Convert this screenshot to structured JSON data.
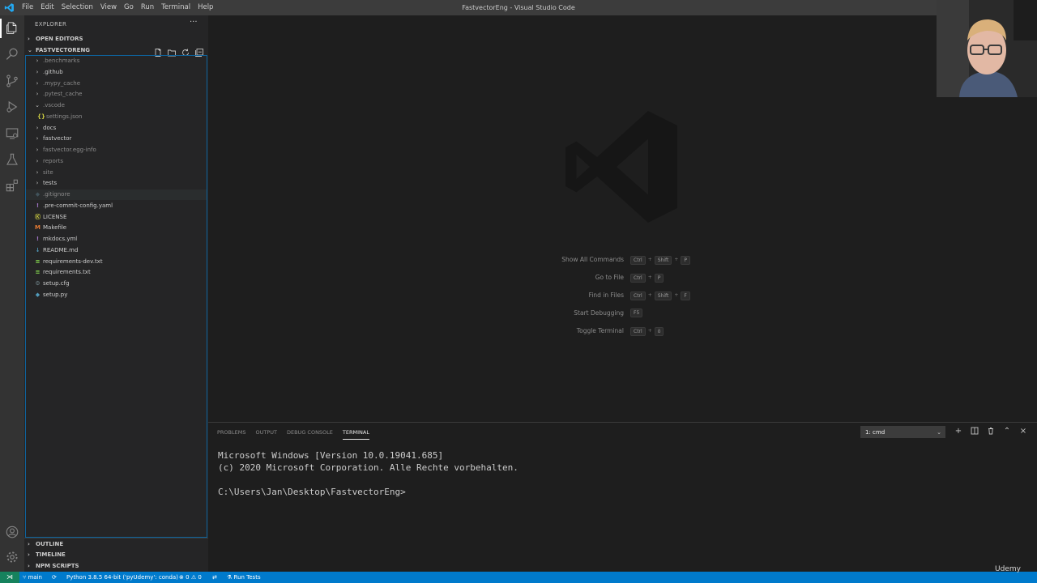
{
  "menu": [
    "File",
    "Edit",
    "Selection",
    "View",
    "Go",
    "Run",
    "Terminal",
    "Help"
  ],
  "window_title": "FastvectorEng - Visual Studio Code",
  "sidebar": {
    "title": "EXPLORER",
    "more_glyph": "···",
    "open_editors": "OPEN EDITORS",
    "root": "FASTVECTORENG",
    "tree": [
      {
        "label": ".benchmarks",
        "kind": "folder",
        "state": "collapsed",
        "dim": true
      },
      {
        "label": ".github",
        "kind": "folder",
        "state": "collapsed",
        "dim": false
      },
      {
        "label": ".mypy_cache",
        "kind": "folder",
        "state": "collapsed",
        "dim": true
      },
      {
        "label": ".pytest_cache",
        "kind": "folder",
        "state": "collapsed",
        "dim": true
      },
      {
        "label": ".vscode",
        "kind": "folder",
        "state": "expanded",
        "dim": true
      },
      {
        "label": "settings.json",
        "kind": "file",
        "icon": "json-icon",
        "dim": true,
        "child": true
      },
      {
        "label": "docs",
        "kind": "folder",
        "state": "collapsed",
        "dim": false
      },
      {
        "label": "fastvector",
        "kind": "folder",
        "state": "collapsed",
        "dim": false
      },
      {
        "label": "fastvector.egg-info",
        "kind": "folder",
        "state": "collapsed",
        "dim": true
      },
      {
        "label": "reports",
        "kind": "folder",
        "state": "collapsed",
        "dim": true
      },
      {
        "label": "site",
        "kind": "folder",
        "state": "collapsed",
        "dim": true
      },
      {
        "label": "tests",
        "kind": "folder",
        "state": "collapsed",
        "dim": false
      },
      {
        "label": ".gitignore",
        "kind": "file",
        "icon": "git-icon",
        "dim": true,
        "hover": true
      },
      {
        "label": ".pre-commit-config.yaml",
        "kind": "file",
        "icon": "yaml-icon",
        "dim": false
      },
      {
        "label": "LICENSE",
        "kind": "file",
        "icon": "license-icon",
        "dim": false
      },
      {
        "label": "Makefile",
        "kind": "file",
        "icon": "makefile-icon",
        "dim": false
      },
      {
        "label": "mkdocs.yml",
        "kind": "file",
        "icon": "yaml-icon",
        "dim": false
      },
      {
        "label": "README.md",
        "kind": "file",
        "icon": "markdown-icon",
        "dim": false
      },
      {
        "label": "requirements-dev.txt",
        "kind": "file",
        "icon": "text-icon",
        "dim": false
      },
      {
        "label": "requirements.txt",
        "kind": "file",
        "icon": "text-icon",
        "dim": false
      },
      {
        "label": "setup.cfg",
        "kind": "file",
        "icon": "settings-file-icon",
        "dim": false
      },
      {
        "label": "setup.py",
        "kind": "file",
        "icon": "python-icon",
        "dim": false
      }
    ],
    "outline": "OUTLINE",
    "timeline": "TIMELINE",
    "npm_scripts": "NPM SCRIPTS"
  },
  "icon_glyphs": {
    "json-icon": "{}",
    "git-icon": "◆",
    "yaml-icon": "!",
    "license-icon": "Ⓚ",
    "makefile-icon": "M",
    "markdown-icon": "↓",
    "text-icon": "≡",
    "settings-file-icon": "⚙",
    "python-icon": "◆"
  },
  "icon_colors": {
    "json-icon": "#cbcb41",
    "git-icon": "#41535b",
    "yaml-icon": "#a074c4",
    "license-icon": "#cbcb41",
    "makefile-icon": "#e37933",
    "markdown-icon": "#519aba",
    "text-icon": "#89e051",
    "settings-file-icon": "#6d8086",
    "python-icon": "#519aba"
  },
  "shortcuts": [
    {
      "label": "Show All Commands",
      "keys": [
        "Ctrl",
        "Shift",
        "P"
      ]
    },
    {
      "label": "Go to File",
      "keys": [
        "Ctrl",
        "P"
      ]
    },
    {
      "label": "Find in Files",
      "keys": [
        "Ctrl",
        "Shift",
        "F"
      ]
    },
    {
      "label": "Start Debugging",
      "keys": [
        "F5"
      ]
    },
    {
      "label": "Toggle Terminal",
      "keys": [
        "Ctrl",
        "ö"
      ]
    }
  ],
  "panel": {
    "tabs": [
      "PROBLEMS",
      "OUTPUT",
      "DEBUG CONSOLE",
      "TERMINAL"
    ],
    "active_tab": "TERMINAL",
    "terminal_select": "1: cmd",
    "terminal_lines": [
      "Microsoft Windows [Version 10.0.19041.685]",
      "(c) 2020 Microsoft Corporation. Alle Rechte vorbehalten.",
      "",
      "C:\\Users\\Jan\\Desktop\\FastvectorEng>"
    ]
  },
  "statusbar": {
    "branch": "main",
    "python": "Python 3.8.5 64-bit ('pyUdemy': conda)",
    "errors": "0",
    "warnings": "0",
    "run_tests": "Run Tests"
  },
  "watermark_text": "Udemy",
  "colors": {
    "accent": "#007acc",
    "remote": "#16825d",
    "sidebar_bg": "#252526",
    "editor_bg": "#1e1e1e"
  }
}
